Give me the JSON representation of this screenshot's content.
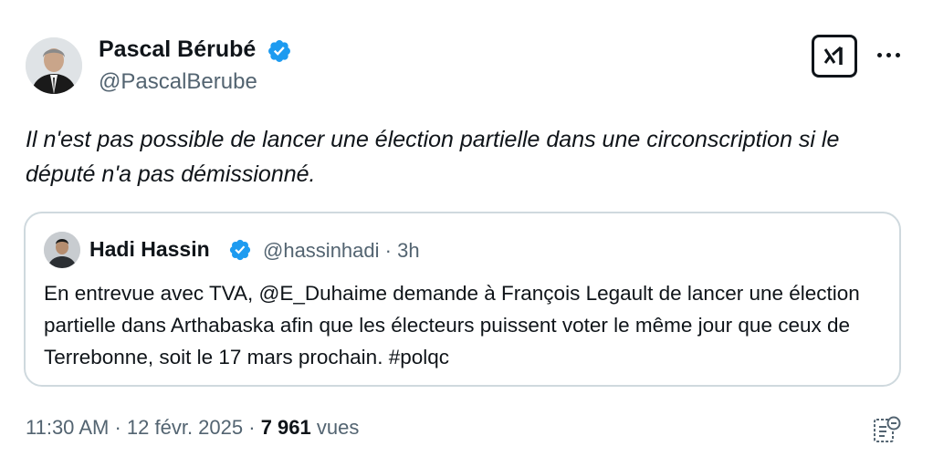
{
  "author": {
    "name": "Pascal Bérubé",
    "handle": "@PascalBerube",
    "verified_color": "#1d9bf0"
  },
  "tweet": {
    "text": "Il n'est pas possible de lancer une élection partielle dans une circonscription si le député n'a pas démissionné."
  },
  "quoted": {
    "name": "Hadi Hassin",
    "handle": "@hassinhadi",
    "separator": "·",
    "time": "3h",
    "text": "En entrevue avec TVA, @E_Duhaime demande à François Legault de lancer une élection partielle dans Arthabaska afin que les électeurs puissent voter le même jour que ceux de Terrebonne, soit le 17 mars prochain. #polqc"
  },
  "footer": {
    "time": "11:30 AM",
    "sep1": "·",
    "date": "12 févr. 2025",
    "sep2": "·",
    "views_count": "7 961",
    "views_label": "vues"
  },
  "icons": {
    "verified": "verified-badge-icon",
    "grok": "grok-icon",
    "more": "more-dots-icon",
    "analytics": "analytics-icon"
  }
}
